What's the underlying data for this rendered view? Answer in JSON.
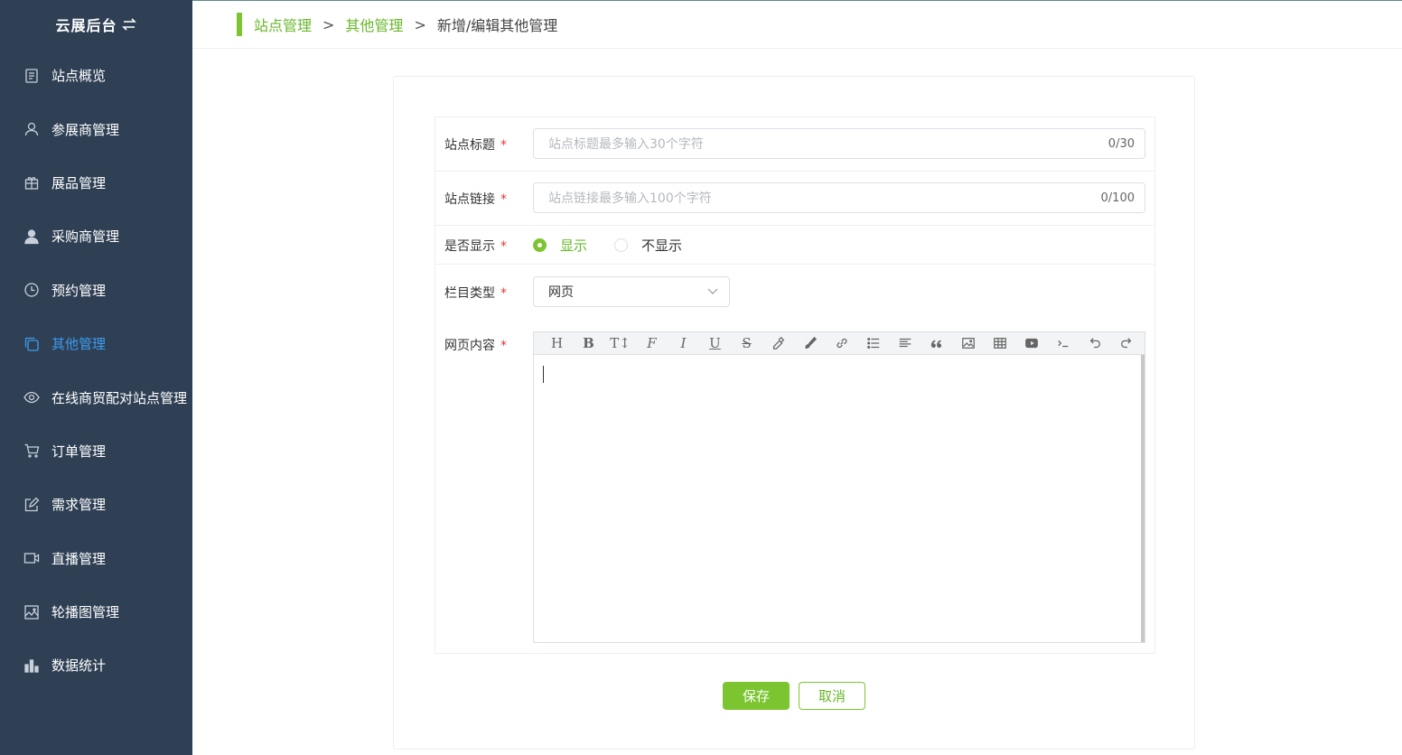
{
  "sidebar": {
    "brand": "云展后台",
    "items": [
      {
        "label": "站点概览",
        "icon": "document-icon"
      },
      {
        "label": "参展商管理",
        "icon": "user-icon"
      },
      {
        "label": "展品管理",
        "icon": "gift-icon"
      },
      {
        "label": "采购商管理",
        "icon": "user-filled-icon"
      },
      {
        "label": "预约管理",
        "icon": "clock-icon"
      },
      {
        "label": "其他管理",
        "icon": "copy-icon",
        "active": true
      },
      {
        "label": "在线商贸配对站点管理",
        "icon": "eye-icon"
      },
      {
        "label": "订单管理",
        "icon": "cart-icon"
      },
      {
        "label": "需求管理",
        "icon": "edit-icon"
      },
      {
        "label": "直播管理",
        "icon": "video-icon"
      },
      {
        "label": "轮播图管理",
        "icon": "image-icon"
      },
      {
        "label": "数据统计",
        "icon": "bar-chart-icon"
      }
    ]
  },
  "breadcrumb": {
    "items": [
      "站点管理",
      "其他管理",
      "新增/编辑其他管理"
    ],
    "separator": ">"
  },
  "form": {
    "title": {
      "label": "站点标题",
      "placeholder": "站点标题最多输入30个字符",
      "count": "0/30"
    },
    "link": {
      "label": "站点链接",
      "placeholder": "站点链接最多输入100个字符",
      "count": "0/100"
    },
    "display": {
      "label": "是否显示",
      "options": [
        "显示",
        "不显示"
      ],
      "selected": "显示"
    },
    "column_type": {
      "label": "栏目类型",
      "value": "网页"
    },
    "content": {
      "label": "网页内容"
    },
    "required_mark": "*"
  },
  "toolbar_icons": [
    "heading-icon",
    "bold-icon",
    "text-size-icon",
    "font-icon",
    "italic-icon",
    "underline-icon",
    "strikethrough-icon",
    "highlighter-icon",
    "brush-icon",
    "link-icon",
    "unordered-list-icon",
    "align-left-icon",
    "blockquote-icon",
    "image-icon",
    "table-icon",
    "video-icon",
    "code-icon",
    "undo-icon",
    "redo-icon"
  ],
  "toolbar_glyphs": [
    "H",
    "B",
    "T↕",
    "F",
    "I",
    "U",
    "S"
  ],
  "actions": {
    "save": "保存",
    "cancel": "取消"
  },
  "colors": {
    "sidebar": "#2f4055",
    "accent": "#7cc531",
    "active_nav": "#3c9cf0"
  }
}
